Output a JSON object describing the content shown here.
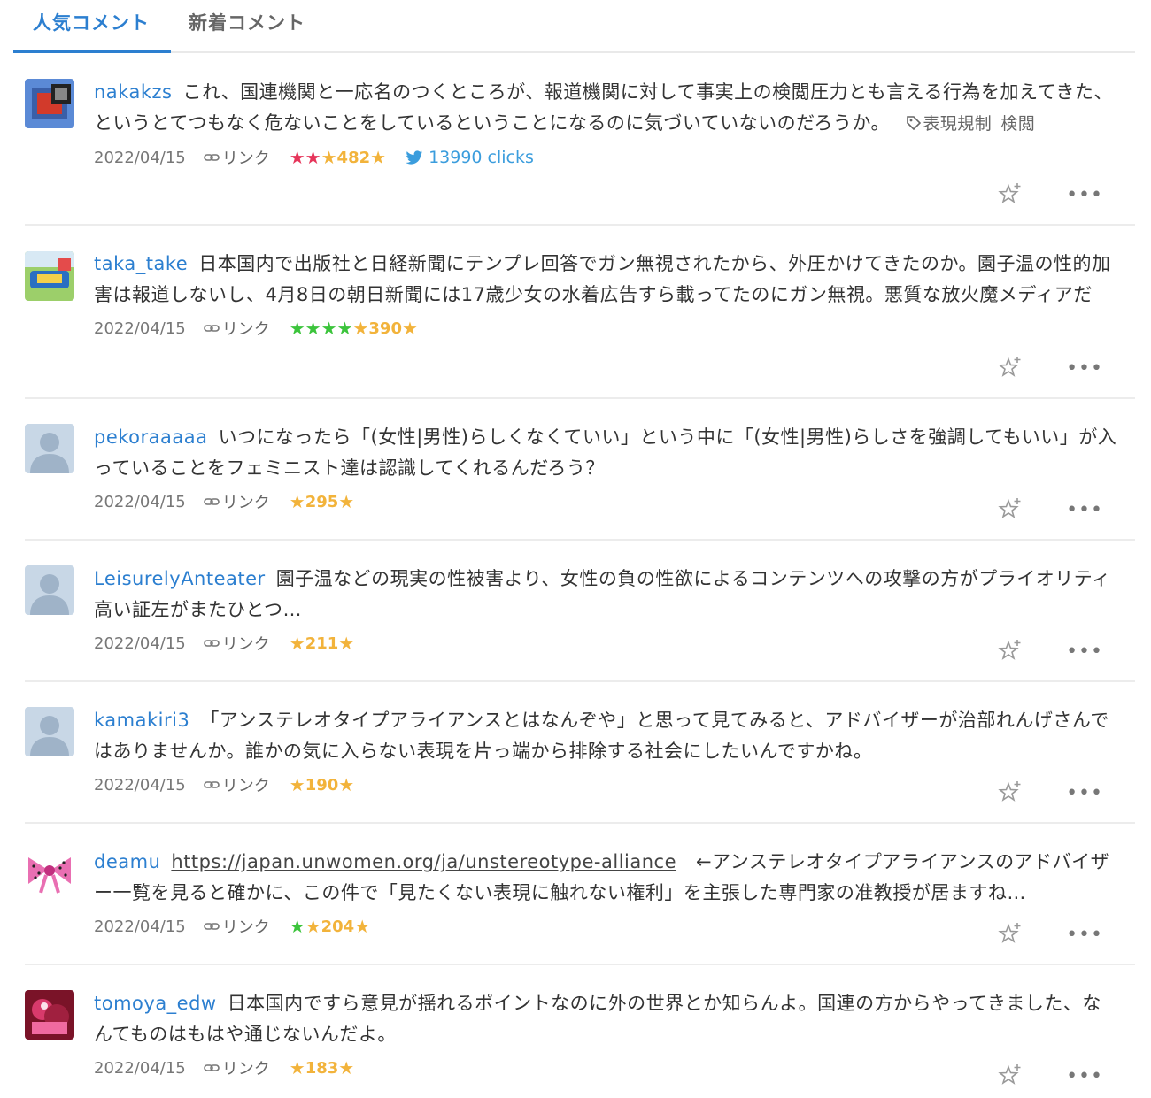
{
  "tabs": {
    "popular": "人気コメント",
    "latest": "新着コメント"
  },
  "permalink_label": "リンク",
  "comments": [
    {
      "user": "nakakzs",
      "text": "これ、国連機関と一応名のつくところが、報道機関に対して事実上の検閲圧力とも言える行為を加えてきた、というとてつもなく危ないことをしているということになるのに気づいていないのだろうか。",
      "tags": [
        "表現規制",
        "検閲"
      ],
      "date": "2022/04/15",
      "stars": {
        "red": "★★",
        "green": "",
        "yellow": "★",
        "count": "482",
        "trail": "★"
      },
      "clicks": "13990 clicks"
    },
    {
      "user": "taka_take",
      "text": "日本国内で出版社と日経新聞にテンプレ回答でガン無視されたから、外圧かけてきたのか。園子温の性的加害は報道しないし、4月8日の朝日新聞には17歳少女の水着広告すら載ってたのにガン無視。悪質な放火魔メディアだ",
      "date": "2022/04/15",
      "stars": {
        "red": "",
        "green": "★★★★",
        "yellow": "★",
        "count": "390",
        "trail": "★"
      }
    },
    {
      "user": "pekoraaaaa",
      "text": "いつになったら「(女性|男性)らしくなくていい」という中に「(女性|男性)らしさを強調してもいい」が入っていることをフェミニスト達は認識してくれるんだろう？",
      "date": "2022/04/15",
      "stars": {
        "red": "",
        "green": "",
        "yellow": "★",
        "count": "295",
        "trail": "★"
      }
    },
    {
      "user": "LeisurelyAnteater",
      "text": "園子温などの現実の性被害より、女性の負の性欲によるコンテンツへの攻撃の方がプライオリティ高い証左がまたひとつ…",
      "date": "2022/04/15",
      "stars": {
        "red": "",
        "green": "",
        "yellow": "★",
        "count": "211",
        "trail": "★"
      }
    },
    {
      "user": "kamakiri3",
      "text": "「アンステレオタイプアライアンスとはなんぞや」と思って見てみると、アドバイザーが治部れんげさんではありませんか。誰かの気に入らない表現を片っ端から排除する社会にしたいんですかね。",
      "date": "2022/04/15",
      "stars": {
        "red": "",
        "green": "",
        "yellow": "★",
        "count": "190",
        "trail": "★"
      }
    },
    {
      "user": "deamu",
      "link": "https://japan.unwomen.org/ja/unstereotype-alliance",
      "text": "←アンステレオタイプアライアンスのアドバイザー一覧を見ると確かに、この件で「見たくない表現に触れない権利」を主張した専門家の准教授が居ますね…",
      "date": "2022/04/15",
      "stars": {
        "red": "",
        "green": "★",
        "yellow": "★",
        "count": "204",
        "trail": "★"
      }
    },
    {
      "user": "tomoya_edw",
      "text": "日本国内ですら意見が揺れるポイントなのに外の世界とか知らんよ。国連の方からやってきました、なんてものはもはや通じないんだよ。",
      "date": "2022/04/15",
      "stars": {
        "red": "",
        "green": "",
        "yellow": "★",
        "count": "183",
        "trail": "★"
      }
    }
  ]
}
